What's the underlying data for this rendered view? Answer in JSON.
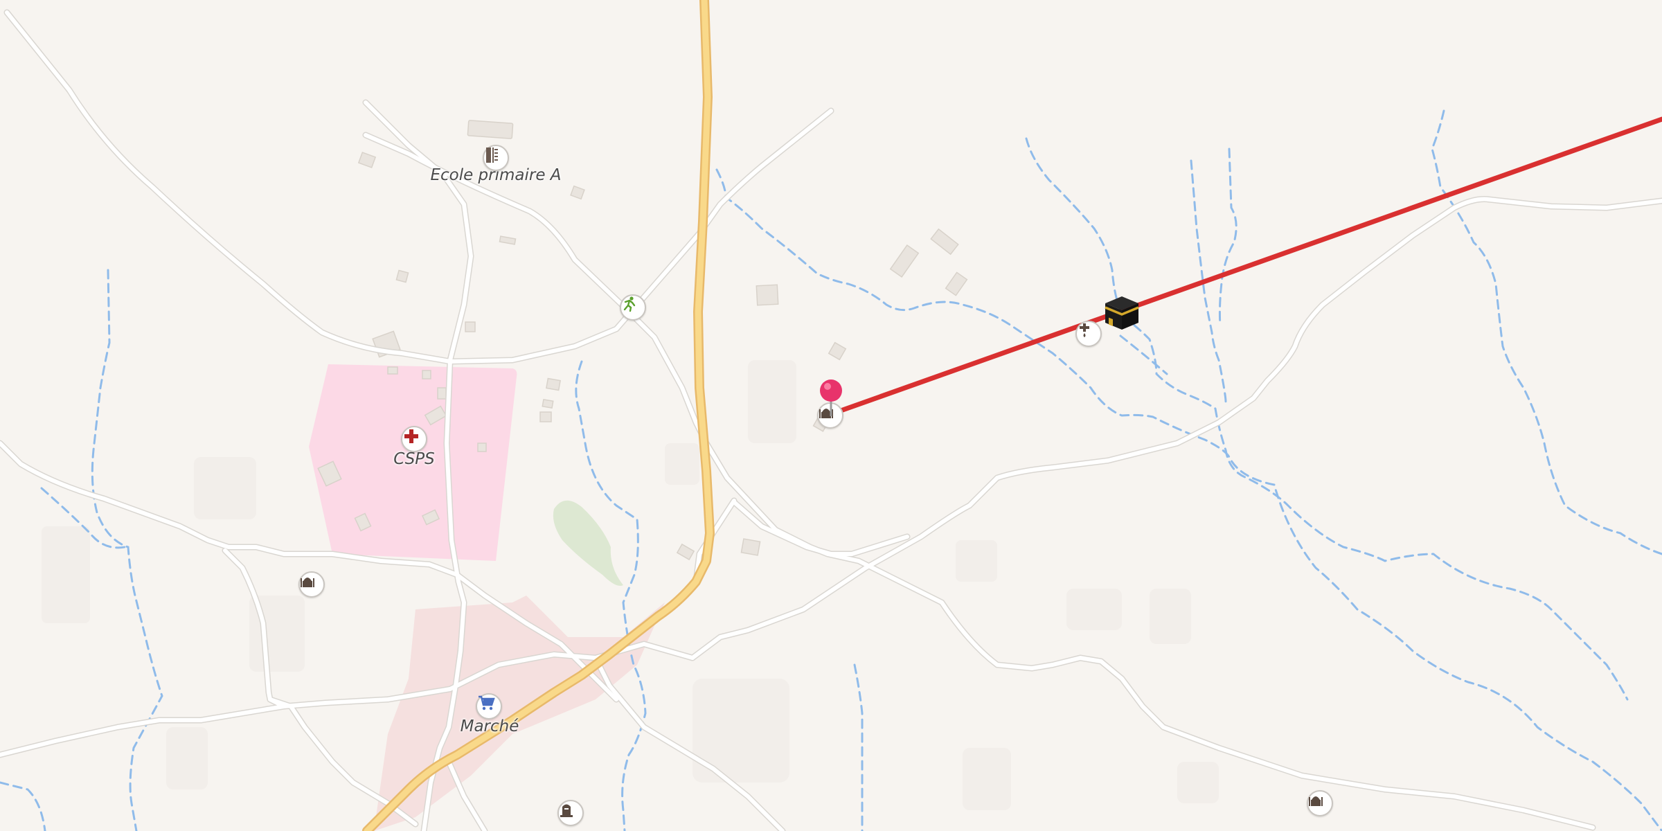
{
  "map": {
    "labels": {
      "school": "Ecole primaire A",
      "health_center": "CSPS",
      "market": "Marché"
    },
    "icons": {
      "school": "school-icon",
      "health": "health-cross-icon",
      "market": "shopping-cart-icon",
      "sport": "running-person-icon",
      "mosque": "mosque-icon",
      "water": "water-tap-icon",
      "cemetery": "grave-icon",
      "pin": "location-pin-icon",
      "qibla": "kaaba-icon"
    },
    "colors": {
      "background": "#f7f4f0",
      "road": "#ffffff",
      "road_casing": "#d9d6d1",
      "main_road": "#f9d98a",
      "main_road_casing": "#e8b96a",
      "stream": "#8fbbea",
      "health_area": "#fcd9e6",
      "market_area": "#f5dcdc",
      "park": "#dde8d2",
      "qibla_line": "#d93030",
      "pin": "#e8336b"
    }
  }
}
